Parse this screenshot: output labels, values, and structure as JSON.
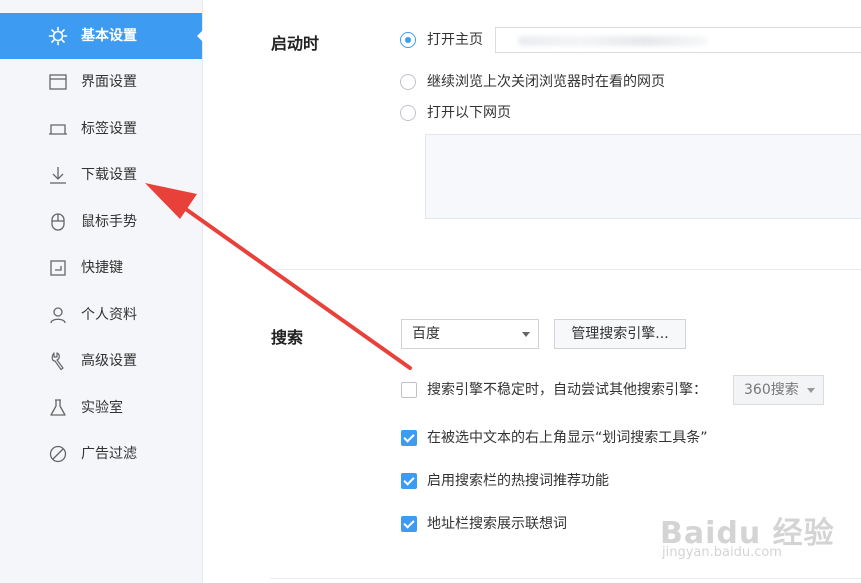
{
  "sidebar": {
    "items": [
      {
        "label": "基本设置",
        "icon": "gear-icon",
        "active": true
      },
      {
        "label": "界面设置",
        "icon": "window-icon",
        "active": false
      },
      {
        "label": "标签设置",
        "icon": "tab-icon",
        "active": false
      },
      {
        "label": "下载设置",
        "icon": "download-icon",
        "active": false
      },
      {
        "label": "鼠标手势",
        "icon": "mouse-icon",
        "active": false
      },
      {
        "label": "快捷键",
        "icon": "shortcut-icon",
        "active": false
      },
      {
        "label": "个人资料",
        "icon": "user-icon",
        "active": false
      },
      {
        "label": "高级设置",
        "icon": "wrench-icon",
        "active": false
      },
      {
        "label": "实验室",
        "icon": "flask-icon",
        "active": false
      },
      {
        "label": "广告过滤",
        "icon": "block-icon",
        "active": false
      }
    ]
  },
  "startup": {
    "title": "启动时",
    "options": [
      {
        "label": "打开主页",
        "checked": true
      },
      {
        "label": "继续浏览上次关闭浏览器时在看的网页",
        "checked": false
      },
      {
        "label": "打开以下网页",
        "checked": false
      }
    ]
  },
  "search": {
    "title": "搜索",
    "engine": "百度",
    "manage_button": "管理搜索引擎...",
    "fallback_label": "搜索引擎不稳定时，自动尝试其他搜索引擎：",
    "fallback_engine": "360搜索",
    "options": [
      {
        "label": "搜索引擎不稳定时，自动尝试其他搜索引擎：",
        "checked": false
      },
      {
        "label": "在被选中文本的右上角显示“划词搜索工具条”",
        "checked": true
      },
      {
        "label": "启用搜索栏的热搜词推荐功能",
        "checked": true
      },
      {
        "label": "地址栏搜索展示联想词",
        "checked": true
      }
    ]
  },
  "watermark": {
    "brand": "Baidu 经验",
    "url": "jingyan.baidu.com"
  },
  "colors": {
    "accent": "#3d9bf2",
    "annotation_arrow": "#e8413a",
    "sidebar_bg": "#f5f6f9"
  }
}
